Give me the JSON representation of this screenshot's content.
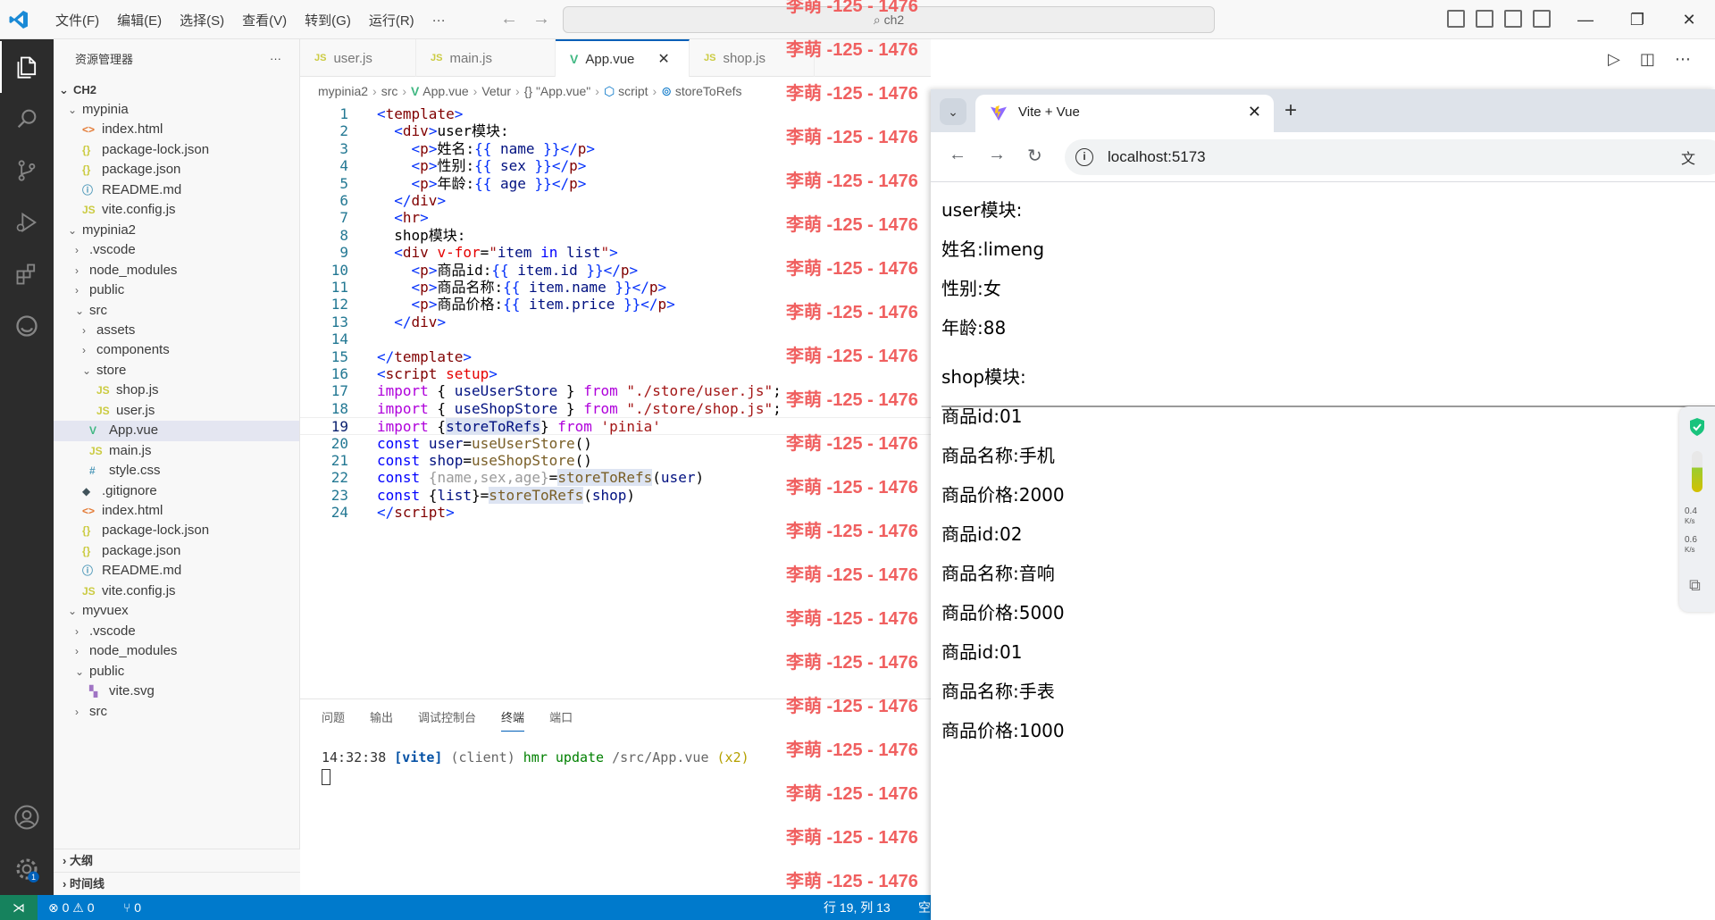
{
  "titlebar": {
    "menus": [
      "文件(F)",
      "编辑(E)",
      "选择(S)",
      "查看(V)",
      "转到(G)",
      "运行(R)",
      "···"
    ],
    "search": "ch2"
  },
  "sidebar": {
    "title": "资源管理器",
    "more": "···",
    "root": "CH2",
    "items": [
      {
        "label": "mypinia",
        "kind": "folder-open",
        "depth": 1
      },
      {
        "label": "index.html",
        "kind": "html",
        "depth": 2
      },
      {
        "label": "package-lock.json",
        "kind": "json",
        "depth": 2
      },
      {
        "label": "package.json",
        "kind": "json",
        "depth": 2
      },
      {
        "label": "README.md",
        "kind": "info",
        "depth": 2
      },
      {
        "label": "vite.config.js",
        "kind": "js",
        "depth": 2
      },
      {
        "label": "mypinia2",
        "kind": "folder-open",
        "depth": 1
      },
      {
        "label": ".vscode",
        "kind": "folder",
        "depth": 2
      },
      {
        "label": "node_modules",
        "kind": "folder",
        "depth": 2
      },
      {
        "label": "public",
        "kind": "folder",
        "depth": 2
      },
      {
        "label": "src",
        "kind": "folder-open",
        "depth": 2
      },
      {
        "label": "assets",
        "kind": "folder",
        "depth": 3
      },
      {
        "label": "components",
        "kind": "folder",
        "depth": 3
      },
      {
        "label": "store",
        "kind": "folder-open",
        "depth": 3
      },
      {
        "label": "shop.js",
        "kind": "js",
        "depth": 4
      },
      {
        "label": "user.js",
        "kind": "js",
        "depth": 4
      },
      {
        "label": "App.vue",
        "kind": "vue",
        "depth": 3,
        "selected": true
      },
      {
        "label": "main.js",
        "kind": "js",
        "depth": 3
      },
      {
        "label": "style.css",
        "kind": "css",
        "depth": 3
      },
      {
        "label": ".gitignore",
        "kind": "git",
        "depth": 2
      },
      {
        "label": "index.html",
        "kind": "html",
        "depth": 2
      },
      {
        "label": "package-lock.json",
        "kind": "json",
        "depth": 2
      },
      {
        "label": "package.json",
        "kind": "json",
        "depth": 2
      },
      {
        "label": "README.md",
        "kind": "info",
        "depth": 2
      },
      {
        "label": "vite.config.js",
        "kind": "js",
        "depth": 2
      },
      {
        "label": "myvuex",
        "kind": "folder-open",
        "depth": 1
      },
      {
        "label": ".vscode",
        "kind": "folder",
        "depth": 2
      },
      {
        "label": "node_modules",
        "kind": "folder",
        "depth": 2
      },
      {
        "label": "public",
        "kind": "folder-open",
        "depth": 2
      },
      {
        "label": "vite.svg",
        "kind": "svg",
        "depth": 3
      },
      {
        "label": "src",
        "kind": "folder",
        "depth": 2
      }
    ],
    "outline": "大纲",
    "timeline": "时间线"
  },
  "tabs": [
    {
      "label": "user.js",
      "icon": "JS",
      "active": false
    },
    {
      "label": "main.js",
      "icon": "JS",
      "active": false
    },
    {
      "label": "App.vue",
      "icon": "V",
      "active": true
    },
    {
      "label": "shop.js",
      "icon": "JS",
      "active": false
    }
  ],
  "breadcrumb": [
    "mypinia2",
    "src",
    "App.vue",
    "Vetur",
    "{} \"App.vue\"",
    "script",
    "storeToRefs"
  ],
  "code": {
    "current_line": 19,
    "lines": [
      [
        [
          "t-br",
          "<"
        ],
        [
          "t-tag",
          "template"
        ],
        [
          "t-br",
          ">"
        ]
      ],
      [
        [
          "t-txt",
          "  "
        ],
        [
          "t-br",
          "<"
        ],
        [
          "t-tag",
          "div"
        ],
        [
          "t-br",
          ">"
        ],
        [
          "t-txt",
          "user模块:"
        ]
      ],
      [
        [
          "t-txt",
          "    "
        ],
        [
          "t-br",
          "<"
        ],
        [
          "t-tag",
          "p"
        ],
        [
          "t-br",
          ">"
        ],
        [
          "t-txt",
          "姓名:"
        ],
        [
          "t-br",
          "{{ "
        ],
        [
          "t-var",
          "name"
        ],
        [
          "t-br",
          " }}"
        ],
        [
          "t-br",
          "</"
        ],
        [
          "t-tag",
          "p"
        ],
        [
          "t-br",
          ">"
        ]
      ],
      [
        [
          "t-txt",
          "    "
        ],
        [
          "t-br",
          "<"
        ],
        [
          "t-tag",
          "p"
        ],
        [
          "t-br",
          ">"
        ],
        [
          "t-txt",
          "性别:"
        ],
        [
          "t-br",
          "{{ "
        ],
        [
          "t-var",
          "sex"
        ],
        [
          "t-br",
          " }}"
        ],
        [
          "t-br",
          "</"
        ],
        [
          "t-tag",
          "p"
        ],
        [
          "t-br",
          ">"
        ]
      ],
      [
        [
          "t-txt",
          "    "
        ],
        [
          "t-br",
          "<"
        ],
        [
          "t-tag",
          "p"
        ],
        [
          "t-br",
          ">"
        ],
        [
          "t-txt",
          "年龄:"
        ],
        [
          "t-br",
          "{{ "
        ],
        [
          "t-var",
          "age"
        ],
        [
          "t-br",
          " }}"
        ],
        [
          "t-br",
          "</"
        ],
        [
          "t-tag",
          "p"
        ],
        [
          "t-br",
          ">"
        ]
      ],
      [
        [
          "t-txt",
          "  "
        ],
        [
          "t-br",
          "</"
        ],
        [
          "t-tag",
          "div"
        ],
        [
          "t-br",
          ">"
        ]
      ],
      [
        [
          "t-txt",
          "  "
        ],
        [
          "t-br",
          "<"
        ],
        [
          "t-tag",
          "hr"
        ],
        [
          "t-br",
          ">"
        ]
      ],
      [
        [
          "t-txt",
          "  shop模块:"
        ]
      ],
      [
        [
          "t-txt",
          "  "
        ],
        [
          "t-br",
          "<"
        ],
        [
          "t-tag",
          "div"
        ],
        [
          "t-txt",
          " "
        ],
        [
          "t-attr",
          "v-for"
        ],
        [
          "t-txt",
          "="
        ],
        [
          "t-str",
          "\""
        ],
        [
          "t-var",
          "item"
        ],
        [
          "t-txt",
          " "
        ],
        [
          "t-kw",
          "in"
        ],
        [
          "t-txt",
          " "
        ],
        [
          "t-var",
          "list"
        ],
        [
          "t-str",
          "\""
        ],
        [
          "t-br",
          ">"
        ]
      ],
      [
        [
          "t-txt",
          "    "
        ],
        [
          "t-br",
          "<"
        ],
        [
          "t-tag",
          "p"
        ],
        [
          "t-br",
          ">"
        ],
        [
          "t-txt",
          "商品id:"
        ],
        [
          "t-br",
          "{{ "
        ],
        [
          "t-var",
          "item.id"
        ],
        [
          "t-br",
          " }}"
        ],
        [
          "t-br",
          "</"
        ],
        [
          "t-tag",
          "p"
        ],
        [
          "t-br",
          ">"
        ]
      ],
      [
        [
          "t-txt",
          "    "
        ],
        [
          "t-br",
          "<"
        ],
        [
          "t-tag",
          "p"
        ],
        [
          "t-br",
          ">"
        ],
        [
          "t-txt",
          "商品名称:"
        ],
        [
          "t-br",
          "{{ "
        ],
        [
          "t-var",
          "item.name"
        ],
        [
          "t-br",
          " }}"
        ],
        [
          "t-br",
          "</"
        ],
        [
          "t-tag",
          "p"
        ],
        [
          "t-br",
          ">"
        ]
      ],
      [
        [
          "t-txt",
          "    "
        ],
        [
          "t-br",
          "<"
        ],
        [
          "t-tag",
          "p"
        ],
        [
          "t-br",
          ">"
        ],
        [
          "t-txt",
          "商品价格:"
        ],
        [
          "t-br",
          "{{ "
        ],
        [
          "t-var",
          "item.price"
        ],
        [
          "t-br",
          " }}"
        ],
        [
          "t-br",
          "</"
        ],
        [
          "t-tag",
          "p"
        ],
        [
          "t-br",
          ">"
        ]
      ],
      [
        [
          "t-txt",
          "  "
        ],
        [
          "t-br",
          "</"
        ],
        [
          "t-tag",
          "div"
        ],
        [
          "t-br",
          ">"
        ]
      ],
      [
        [
          "t-txt",
          ""
        ]
      ],
      [
        [
          "t-br",
          "</"
        ],
        [
          "t-tag",
          "template"
        ],
        [
          "t-br",
          ">"
        ]
      ],
      [
        [
          "t-br",
          "<"
        ],
        [
          "t-tag",
          "script"
        ],
        [
          "t-txt",
          " "
        ],
        [
          "t-attr",
          "setup"
        ],
        [
          "t-br",
          ">"
        ]
      ],
      [
        [
          "t-flow",
          "import"
        ],
        [
          "t-txt",
          " { "
        ],
        [
          "t-var",
          "useUserStore"
        ],
        [
          "t-txt",
          " } "
        ],
        [
          "t-flow",
          "from"
        ],
        [
          "t-txt",
          " "
        ],
        [
          "t-str",
          "\"./store/user.js\""
        ],
        [
          "t-txt",
          ";"
        ]
      ],
      [
        [
          "t-flow",
          "import"
        ],
        [
          "t-txt",
          " { "
        ],
        [
          "t-var",
          "useShopStore"
        ],
        [
          "t-txt",
          " } "
        ],
        [
          "t-flow",
          "from"
        ],
        [
          "t-txt",
          " "
        ],
        [
          "t-str",
          "\"./store/shop.js\""
        ],
        [
          "t-txt",
          ";"
        ]
      ],
      [
        [
          "t-flow",
          "import"
        ],
        [
          "t-txt",
          " {"
        ],
        [
          "t-var hl",
          "storeToRefs"
        ],
        [
          "t-txt",
          "} "
        ],
        [
          "t-flow",
          "from"
        ],
        [
          "t-txt",
          " "
        ],
        [
          "t-str",
          "'pinia'"
        ]
      ],
      [
        [
          "t-kw",
          "const"
        ],
        [
          "t-txt",
          " "
        ],
        [
          "t-var",
          "user"
        ],
        [
          "t-txt",
          "="
        ],
        [
          "t-fn",
          "useUserStore"
        ],
        [
          "t-txt",
          "()"
        ]
      ],
      [
        [
          "t-kw",
          "const"
        ],
        [
          "t-txt",
          " "
        ],
        [
          "t-var",
          "shop"
        ],
        [
          "t-txt",
          "="
        ],
        [
          "t-fn",
          "useShopStore"
        ],
        [
          "t-txt",
          "()"
        ]
      ],
      [
        [
          "t-kw",
          "const"
        ],
        [
          "t-txt",
          " "
        ],
        [
          "t-dim",
          "{name,sex,age}"
        ],
        [
          "t-txt",
          "="
        ],
        [
          "t-fn hl",
          "storeToRefs"
        ],
        [
          "t-txt",
          "("
        ],
        [
          "t-var",
          "user"
        ],
        [
          "t-txt",
          ")"
        ]
      ],
      [
        [
          "t-kw",
          "const"
        ],
        [
          "t-txt",
          " {"
        ],
        [
          "t-var",
          "list"
        ],
        [
          "t-txt",
          "}="
        ],
        [
          "t-fn hl",
          "storeToRefs"
        ],
        [
          "t-txt",
          "("
        ],
        [
          "t-var",
          "shop"
        ],
        [
          "t-txt",
          ")"
        ]
      ],
      [
        [
          "t-br",
          "</"
        ],
        [
          "t-tag",
          "script"
        ],
        [
          "t-br",
          ">"
        ]
      ]
    ]
  },
  "panel": {
    "tabs": [
      "问题",
      "输出",
      "调试控制台",
      "终端",
      "端口"
    ],
    "active_tab": "终端",
    "terminal": {
      "time": "14:32:38",
      "tag": "[vite]",
      "client": "(client)",
      "event": "hmr update",
      "path": "/src/App.vue",
      "count": "(x2)"
    }
  },
  "statusbar": {
    "problems": "⊗ 0 ⚠ 0",
    "ports": "⑂ 0",
    "cursor": "行 19, 列 13",
    "spaces": "空"
  },
  "watermark": "李萌 -125 - 1476",
  "browser": {
    "tab_title": "Vite + Vue",
    "url": "localhost:5173",
    "page": {
      "user_heading": "user模块:",
      "name_line": "姓名:limeng",
      "sex_line": "性别:女",
      "age_line": "年龄:88",
      "shop_heading": "shop模块:",
      "items": [
        {
          "id": "商品id:01",
          "name": "商品名称:手机",
          "price": "商品价格:2000"
        },
        {
          "id": "商品id:02",
          "name": "商品名称:音响",
          "price": "商品价格:5000"
        },
        {
          "id": "商品id:01",
          "name": "商品名称:手表",
          "price": "商品价格:1000"
        }
      ]
    },
    "net_widget": {
      "up": "0.4",
      "down": "0.6",
      "unit": "K/s"
    }
  }
}
